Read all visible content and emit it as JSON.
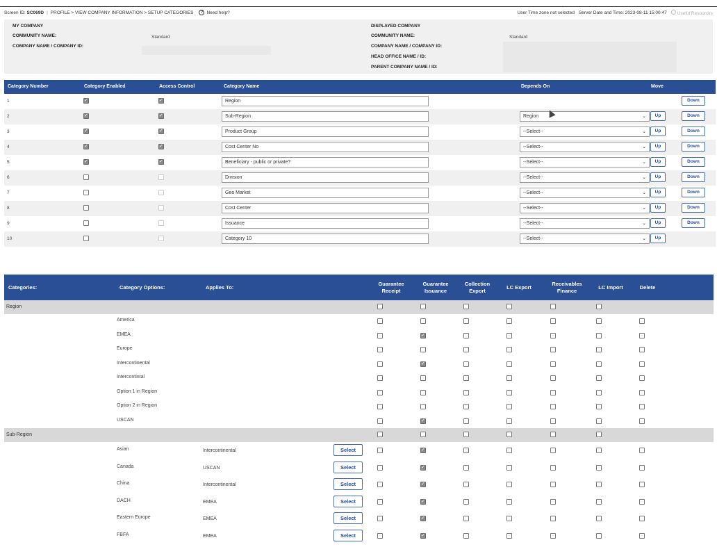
{
  "topbar": {
    "screen_id_label": "Screen ID: ",
    "screen_id": "SC069D",
    "breadcrumb": "PROFILE > VIEW COMPANY INFORMATION > SETUP CATEGORIES",
    "help": "Need help?",
    "timezone": "User Time zone not selected",
    "server_time": "Server Date and Time: 2023-08-11 15:00:47",
    "resources": "Useful Resources"
  },
  "company": {
    "my_company": "MY COMPANY",
    "community_name_label": "COMMUNITY NAME:",
    "community_name": "Standard",
    "company_name_label": "COMPANY NAME / COMPANY ID:",
    "displayed_company": "DISPLAYED COMPANY",
    "d_community_name_label": "COMMUNITY NAME:",
    "d_community_name": "Standard",
    "d_company_name_label": "COMPANY NAME / COMPANY ID:",
    "head_office_label": "HEAD OFFICE NAME / ID:",
    "parent_company_label": "PARENT COMPANY NAME / ID:"
  },
  "category_table": {
    "headers": {
      "number": "Category Number",
      "enabled": "Category Enabled",
      "access": "Access Control",
      "name": "Category Name",
      "depends": "Depends On",
      "move": "Move"
    },
    "up_label": "Up",
    "down_label": "Down",
    "rows": [
      {
        "num": "1",
        "enabled": true,
        "access": true,
        "name": "Region",
        "depends": "",
        "up": false,
        "down": true
      },
      {
        "num": "2",
        "enabled": true,
        "access": true,
        "name": "Sub-Region",
        "depends": "Region",
        "up": true,
        "down": true
      },
      {
        "num": "3",
        "enabled": true,
        "access": true,
        "name": "Product Group",
        "depends": "--Select--",
        "up": true,
        "down": true
      },
      {
        "num": "4",
        "enabled": true,
        "access": true,
        "name": "Cost Center No",
        "depends": "--Select--",
        "up": true,
        "down": true
      },
      {
        "num": "5",
        "enabled": true,
        "access": true,
        "name": "Beneficiary - public or private?",
        "depends": "--Select--",
        "up": true,
        "down": true
      },
      {
        "num": "6",
        "enabled": false,
        "access": false,
        "name": "Division",
        "depends": "--Select--",
        "up": true,
        "down": true
      },
      {
        "num": "7",
        "enabled": false,
        "access": false,
        "name": "Geo Market",
        "depends": "--Select--",
        "up": true,
        "down": true
      },
      {
        "num": "8",
        "enabled": false,
        "access": false,
        "name": "Cost Center",
        "depends": "--Select--",
        "up": true,
        "down": true
      },
      {
        "num": "9",
        "enabled": false,
        "access": false,
        "name": "Issuance",
        "depends": "--Select--",
        "up": true,
        "down": true
      },
      {
        "num": "10",
        "enabled": false,
        "access": false,
        "name": "Category 10",
        "depends": "--Select--",
        "up": true,
        "down": false
      }
    ]
  },
  "options_table": {
    "headers": {
      "categories": "Categories:",
      "options": "Category Options:",
      "applies": "Applies To:",
      "guarantee_receipt": "Guarantee Receipt",
      "guarantee_issuance": "Guarantee Issuance",
      "collection_export": "Collection Export",
      "lc_export": "LC Export",
      "receivables_finance": "Receivables Finance",
      "lc_import": "LC Import",
      "delete": "Delete"
    },
    "select_label": "Select",
    "groups": [
      {
        "name": "Region",
        "options": [
          {
            "name": "America",
            "applies": "",
            "checks": [
              false,
              false,
              false,
              false,
              false,
              false,
              false
            ]
          },
          {
            "name": "EMEA",
            "applies": "",
            "checks": [
              false,
              true,
              false,
              false,
              false,
              false,
              false
            ]
          },
          {
            "name": "Europe",
            "applies": "",
            "checks": [
              false,
              false,
              false,
              false,
              false,
              false,
              false
            ]
          },
          {
            "name": "Intercontinental",
            "applies": "",
            "checks": [
              false,
              true,
              false,
              false,
              false,
              false,
              false
            ]
          },
          {
            "name": "Intercontintal",
            "applies": "",
            "checks": [
              false,
              false,
              false,
              false,
              false,
              false,
              false
            ]
          },
          {
            "name": "Option 1 in Region",
            "applies": "",
            "checks": [
              false,
              false,
              false,
              false,
              false,
              false,
              false
            ]
          },
          {
            "name": "Option 2 in Region",
            "applies": "",
            "checks": [
              false,
              false,
              false,
              false,
              false,
              false,
              false
            ]
          },
          {
            "name": "USCAN",
            "applies": "",
            "checks": [
              false,
              true,
              false,
              false,
              false,
              false,
              false
            ]
          }
        ]
      },
      {
        "name": "Sub-Region",
        "options": [
          {
            "name": "Asian",
            "applies": "Intercontinental",
            "checks": [
              false,
              true,
              false,
              false,
              false,
              false,
              false
            ]
          },
          {
            "name": "Canada",
            "applies": "USCAN",
            "checks": [
              false,
              true,
              false,
              false,
              false,
              false,
              false
            ]
          },
          {
            "name": "China",
            "applies": "Intercontinental",
            "checks": [
              false,
              true,
              false,
              false,
              false,
              false,
              false
            ]
          },
          {
            "name": "DACH",
            "applies": "EMEA",
            "checks": [
              false,
              true,
              false,
              false,
              false,
              false,
              false
            ]
          },
          {
            "name": "Eastern Europe",
            "applies": "EMEA",
            "checks": [
              false,
              true,
              false,
              false,
              false,
              false,
              false
            ]
          },
          {
            "name": "FBFA",
            "applies": "EMEA",
            "checks": [
              false,
              true,
              false,
              false,
              false,
              false,
              false
            ]
          }
        ]
      }
    ]
  }
}
